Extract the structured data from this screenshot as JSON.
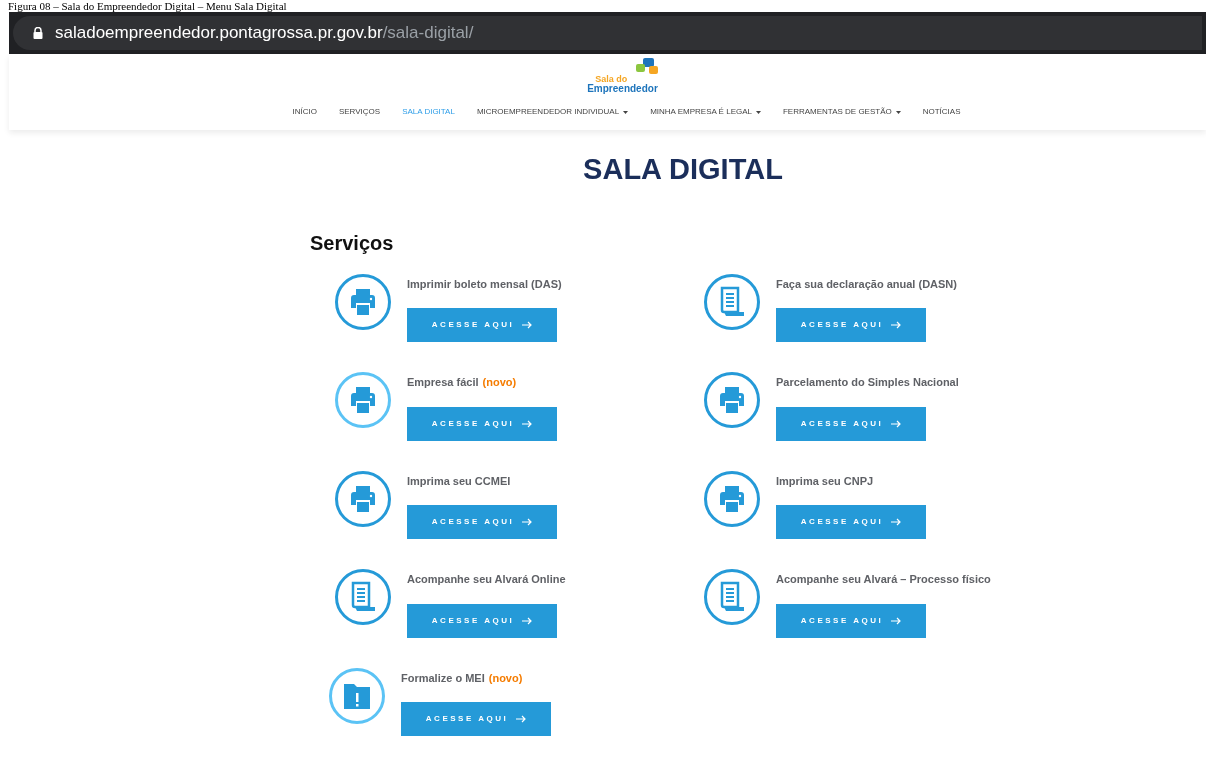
{
  "caption": "Figura 08 – Sala do Empreendedor Digital – Menu Sala Digital",
  "address_bar": {
    "domain": "saladoempreendedor.pontagrossa.pr.gov.br",
    "path": "/sala-digital/"
  },
  "logo": {
    "line_1": "Sala do",
    "line_2": "Empreendedor"
  },
  "nav": [
    {
      "label": "INÍCIO",
      "selected": false,
      "dropdown": false
    },
    {
      "label": "SERVIÇOS",
      "selected": false,
      "dropdown": false
    },
    {
      "label": "SALA DIGITAL",
      "selected": true,
      "dropdown": false
    },
    {
      "label": "MICROEMPREENDEDOR INDIVIDUAL",
      "selected": false,
      "dropdown": true
    },
    {
      "label": "MINHA EMPRESA É LEGAL",
      "selected": false,
      "dropdown": true
    },
    {
      "label": "FERRAMENTAS DE GESTÃO",
      "selected": false,
      "dropdown": true
    },
    {
      "label": "NOTÍCIAS",
      "selected": false,
      "dropdown": false
    }
  ],
  "page_title": "SALA DIGITAL",
  "section_title": "Serviços",
  "services": [
    {
      "title": "Imprimir boleto mensal (DAS)",
      "kind": "printer",
      "color": "#259ad8",
      "button": "ACESSE AQUI"
    },
    {
      "title": "Faça sua declaração anual (DASN)",
      "kind": "document",
      "color": "#259ad8",
      "button": "ACESSE AQUI"
    },
    {
      "title": "Empresa fácil",
      "badge": "(novo)",
      "kind": "printer",
      "color": "#5bc3f5",
      "button": "ACESSE AQUI"
    },
    {
      "title": "Parcelamento do Simples Nacional",
      "kind": "printer",
      "color": "#259ad8",
      "button": "ACESSE AQUI"
    },
    {
      "title": "Imprima seu CCMEI",
      "kind": "printer",
      "color": "#259ad8",
      "button": "ACESSE AQUI"
    },
    {
      "title": "Imprima seu CNPJ",
      "kind": "printer",
      "color": "#259ad8",
      "button": "ACESSE AQUI"
    },
    {
      "title": "Acompanhe seu Alvará Online",
      "kind": "document",
      "color": "#259ad8",
      "button": "ACESSE AQUI"
    },
    {
      "title": "Acompanhe seu Alvará – Processo físico",
      "kind": "document",
      "color": "#259ad8",
      "button": "ACESSE AQUI"
    },
    {
      "title": "Formalize o MEI",
      "badge": "(novo)",
      "kind": "folder-alert",
      "color": "#5bc3f5",
      "button": "ACESSE AQUI"
    }
  ]
}
